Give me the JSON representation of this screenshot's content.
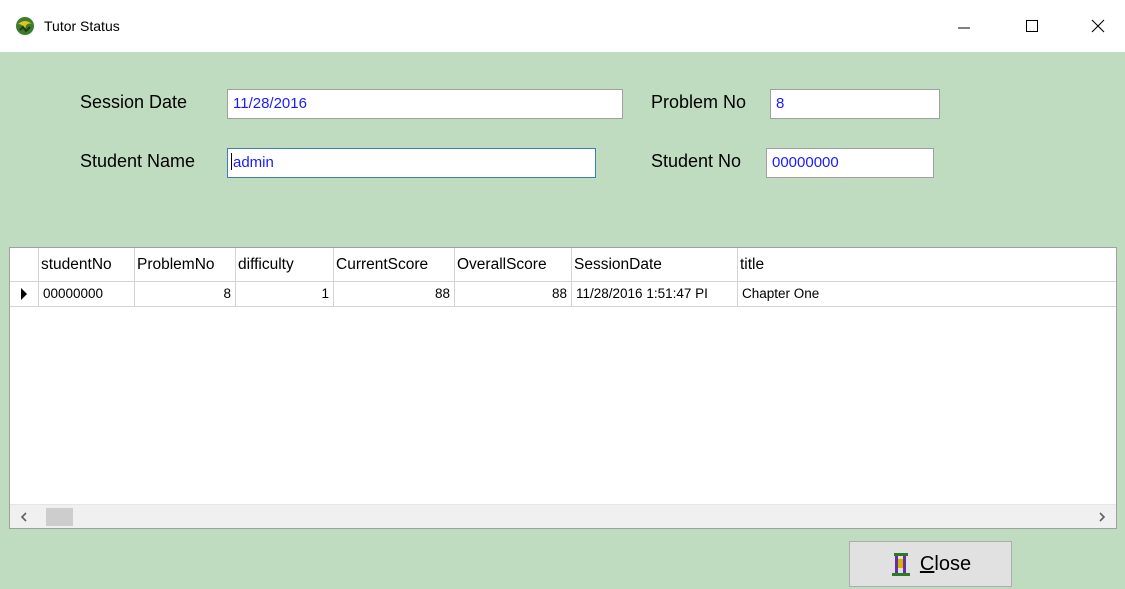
{
  "window": {
    "title": "Tutor Status",
    "icon": "tutor-app-icon",
    "controls": {
      "minimize": "minimize-icon",
      "maximize": "maximize-icon",
      "close": "close-icon"
    }
  },
  "form": {
    "session_date_label": "Session Date",
    "session_date_value": "11/28/2016",
    "problem_no_label": "Problem No",
    "problem_no_value": "8",
    "student_name_label": "Student Name",
    "student_name_value": "admin",
    "student_no_label": "Student No",
    "student_no_value": "00000000"
  },
  "grid": {
    "columns": [
      "studentNo",
      "ProblemNo",
      "difficulty",
      "CurrentScore",
      "OverallScore",
      "SessionDate",
      "title"
    ],
    "rows": [
      {
        "studentNo": "00000000",
        "ProblemNo": "8",
        "difficulty": "1",
        "CurrentScore": "88",
        "OverallScore": "88",
        "SessionDate": "11/28/2016 1:51:47 PI",
        "title": "Chapter One"
      }
    ],
    "current_row_icon": "row-pointer-icon"
  },
  "close_button": {
    "label_underlined": "C",
    "label_rest": "lose",
    "icon": "door-exit-icon"
  },
  "colors": {
    "window_background": "#c0dcc0",
    "field_text": "#1a1aff",
    "focus_border": "#3c7fb1"
  }
}
